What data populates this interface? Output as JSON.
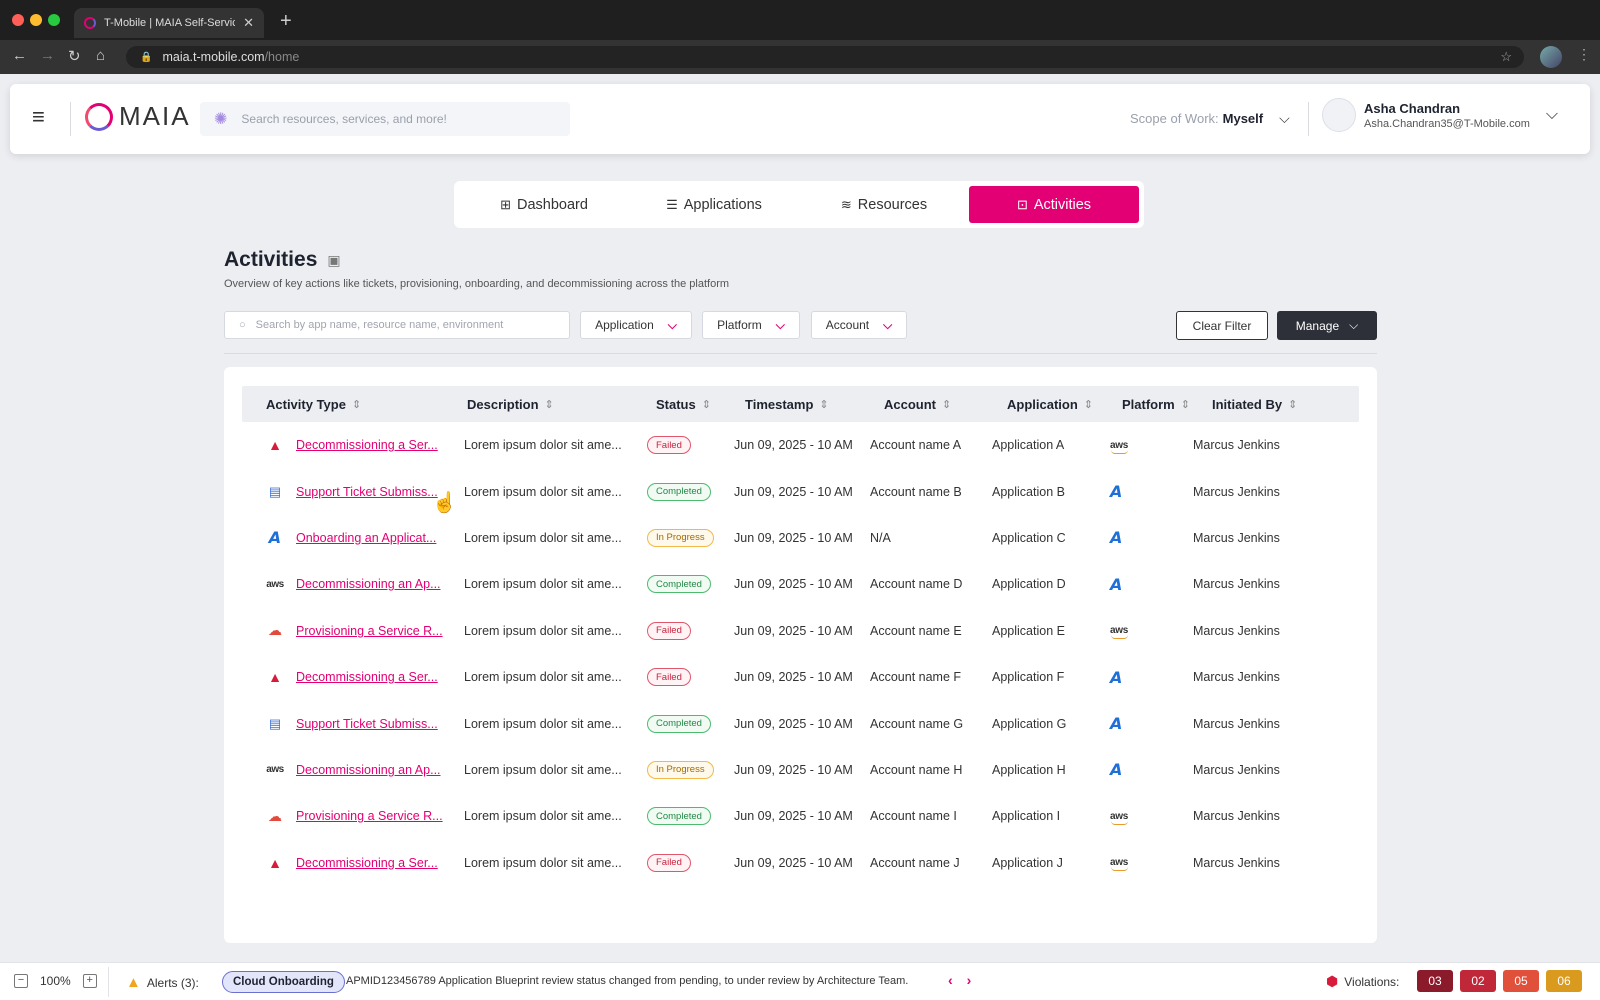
{
  "browser": {
    "tab_title": "T-Mobile | MAIA Self-Service",
    "url_host": "maia.t-mobile.com",
    "url_path": "/home"
  },
  "header": {
    "logo_text": "MAIA",
    "search_placeholder": "Search resources, services, and more!",
    "scope_label": "Scope of Work:",
    "scope_value": "Myself",
    "user_name": "Asha Chandran",
    "user_email": "Asha.Chandran35@T-Mobile.com"
  },
  "nav": {
    "tabs": [
      {
        "label": "Dashboard",
        "icon": "grid-icon"
      },
      {
        "label": "Applications",
        "icon": "stack-icon"
      },
      {
        "label": "Resources",
        "icon": "layers-icon"
      },
      {
        "label": "Activities",
        "icon": "activity-icon",
        "active": true
      }
    ]
  },
  "page": {
    "title": "Activities",
    "subtitle": "Overview of key actions like tickets, provisioning, onboarding, and decommissioning across the platform"
  },
  "filters": {
    "search_placeholder": "Search by app name, resource name, environment",
    "application_label": "Application",
    "platform_label": "Platform",
    "account_label": "Account",
    "clear_label": "Clear Filter",
    "manage_label": "Manage"
  },
  "table": {
    "columns": [
      "Activity Type",
      "Description",
      "Status",
      "Timestamp",
      "Account",
      "Application",
      "Platform",
      "Initiated By"
    ],
    "rows": [
      {
        "type_icon": "alert",
        "activity": "Decommissioning a Ser...",
        "description": "Lorem ipsum dolor sit ame...",
        "status": "Failed",
        "timestamp": "Jun 09, 2025 - 10 AM",
        "account": "Account name A",
        "application": "Application A",
        "platform": "aws",
        "initiated_by": "Marcus Jenkins"
      },
      {
        "type_icon": "ticket",
        "activity": "Support Ticket Submiss...",
        "description": "Lorem ipsum dolor sit ame...",
        "status": "Completed",
        "timestamp": "Jun 09, 2025 - 10 AM",
        "account": "Account name B",
        "application": "Application B",
        "platform": "azure",
        "initiated_by": "Marcus Jenkins"
      },
      {
        "type_icon": "azure",
        "activity": "Onboarding an Applicat...",
        "description": "Lorem ipsum dolor sit ame...",
        "status": "In Progress",
        "timestamp": "Jun 09, 2025 - 10 AM",
        "account": "N/A",
        "application": "Application C",
        "platform": "azure",
        "initiated_by": "Marcus Jenkins"
      },
      {
        "type_icon": "aws",
        "activity": "Decommissioning an Ap...",
        "description": "Lorem ipsum dolor sit ame...",
        "status": "Completed",
        "timestamp": "Jun 09, 2025 - 10 AM",
        "account": "Account name D",
        "application": "Application D",
        "platform": "azure",
        "initiated_by": "Marcus Jenkins"
      },
      {
        "type_icon": "gcp",
        "activity": "Provisioning a Service R...",
        "description": "Lorem ipsum dolor sit ame...",
        "status": "Failed",
        "timestamp": "Jun 09, 2025 - 10 AM",
        "account": "Account name E",
        "application": "Application E",
        "platform": "aws",
        "initiated_by": "Marcus Jenkins"
      },
      {
        "type_icon": "alert",
        "activity": "Decommissioning a Ser...",
        "description": "Lorem ipsum dolor sit ame...",
        "status": "Failed",
        "timestamp": "Jun 09, 2025 - 10 AM",
        "account": "Account name F",
        "application": "Application F",
        "platform": "azure",
        "initiated_by": "Marcus Jenkins"
      },
      {
        "type_icon": "ticket",
        "activity": "Support Ticket Submiss...",
        "description": "Lorem ipsum dolor sit ame...",
        "status": "Completed",
        "timestamp": "Jun 09, 2025 - 10 AM",
        "account": "Account name G",
        "application": "Application G",
        "platform": "azure",
        "initiated_by": "Marcus Jenkins"
      },
      {
        "type_icon": "aws",
        "activity": "Decommissioning an Ap...",
        "description": "Lorem ipsum dolor sit ame...",
        "status": "In Progress",
        "timestamp": "Jun 09, 2025 - 10 AM",
        "account": "Account name H",
        "application": "Application H",
        "platform": "azure",
        "initiated_by": "Marcus Jenkins"
      },
      {
        "type_icon": "gcp",
        "activity": "Provisioning a Service R...",
        "description": "Lorem ipsum dolor sit ame...",
        "status": "Completed",
        "timestamp": "Jun 09, 2025 - 10 AM",
        "account": "Account name I",
        "application": "Application I",
        "platform": "aws",
        "initiated_by": "Marcus Jenkins"
      },
      {
        "type_icon": "alert",
        "activity": "Decommissioning a Ser...",
        "description": "Lorem ipsum dolor sit ame...",
        "status": "Failed",
        "timestamp": "Jun 09, 2025 - 10 AM",
        "account": "Account name J",
        "application": "Application J",
        "platform": "aws",
        "initiated_by": "Marcus Jenkins"
      }
    ]
  },
  "status_bar": {
    "zoom": "100%",
    "alerts_label": "Alerts (3):",
    "alert_tag": "Cloud Onboarding",
    "alert_message": "APMID123456789 Application Blueprint review status changed from pending, to under review by Architecture Team.",
    "violations_label": "Violations:",
    "violation_counts": [
      {
        "value": "03",
        "color": "#8b1a2b"
      },
      {
        "value": "02",
        "color": "#c0283a"
      },
      {
        "value": "05",
        "color": "#e0503a"
      },
      {
        "value": "06",
        "color": "#d99a1e"
      }
    ]
  },
  "colors": {
    "accent": "#e20074",
    "dark_button": "#2d3038"
  }
}
